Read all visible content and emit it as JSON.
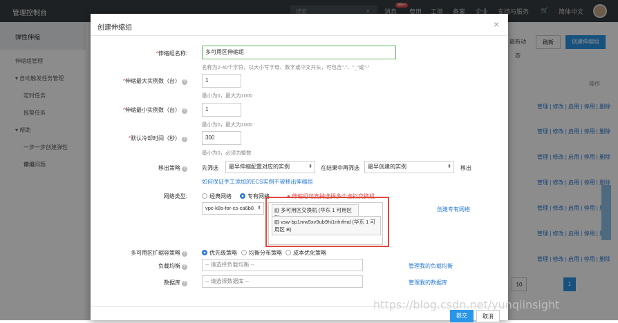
{
  "topbar": {
    "brand": "管理控制台",
    "search_placeholder": "搜索",
    "badge": "99+",
    "nav": [
      "消息",
      "费用",
      "工单",
      "备案",
      "企业",
      "支持与服务",
      "简体中文"
    ]
  },
  "sidebar": {
    "header": "弹性伸缩",
    "items": [
      {
        "label": "伸缩组管理"
      },
      {
        "label": "自动触发任务管理"
      },
      {
        "label": "定时任务"
      },
      {
        "label": "报警任务"
      },
      {
        "label": "帮助"
      },
      {
        "label": "一步一步创建弹性伸缩"
      },
      {
        "label": "常见问题"
      }
    ]
  },
  "main": {
    "activity_label": "最新动态",
    "refresh_label": "刷新",
    "create_label": "创建伸缩组",
    "col_header": "操作",
    "row_ops": "管理 | 修改 | 启用 | 停用 | 删除",
    "page_size": "10",
    "page_current": "1"
  },
  "modal": {
    "title": "创建伸缩组",
    "close": "×",
    "name": {
      "label": "伸缩组名称:",
      "value": "多可用区伸缩组",
      "hint": "名称为2-40个字符，以大小写字母、数字或中文开头，可包含\".\"、\"_\"或\"-\""
    },
    "max": {
      "label": "伸缩最大实例数（台）",
      "value": "1",
      "hint": "最小为0，最大为1000"
    },
    "min": {
      "label": "伸缩最小实例数（台）",
      "value": "1",
      "hint": "最小为0，最大为1000"
    },
    "cooldown": {
      "label": "默认冷却时间（秒）",
      "value": "300",
      "hint": "最小为0，必须为整数"
    },
    "removal": {
      "label": "移出策略",
      "prefix": "先筛选",
      "first": "最早伸缩配置对应的实例",
      "middle": "在结果中再筛选",
      "second": "最早创建的实例",
      "suffix": "移出",
      "link": "如何保证手工添加的ECS实例不被移出伸缩组"
    },
    "network": {
      "label": "网络类型:",
      "classic": "经典网络",
      "vpc": "专有网络",
      "warning": "伸缩组可支持选择多个虚拟交换机",
      "vpc_select": "vpc-k8s-for-cs-ca6b8",
      "vswitch1": "多可用区交换机 (华东 1 可用区 D)",
      "vswitch2": "vsw-bp1mw5xv9ub9hi1nhrfmd (华东 1 可用区 B)",
      "create_link": "创建专有网络"
    },
    "multi_az": {
      "label": "多可用区扩缩容策略",
      "opt1": "优先级策略",
      "opt2": "均衡分布策略",
      "opt3": "成本优化策略"
    },
    "slb": {
      "label": "负载均衡",
      "placeholder": "-- 请选择负载均衡 --",
      "link": "管理我的负载均衡"
    },
    "db": {
      "label": "数据库",
      "placeholder": "-- 请选择数据库 --",
      "link": "管理我的数据库"
    },
    "submit": "提交",
    "cancel": "取消"
  },
  "watermark": "https://blog.csdn.net/yunqiinsight"
}
